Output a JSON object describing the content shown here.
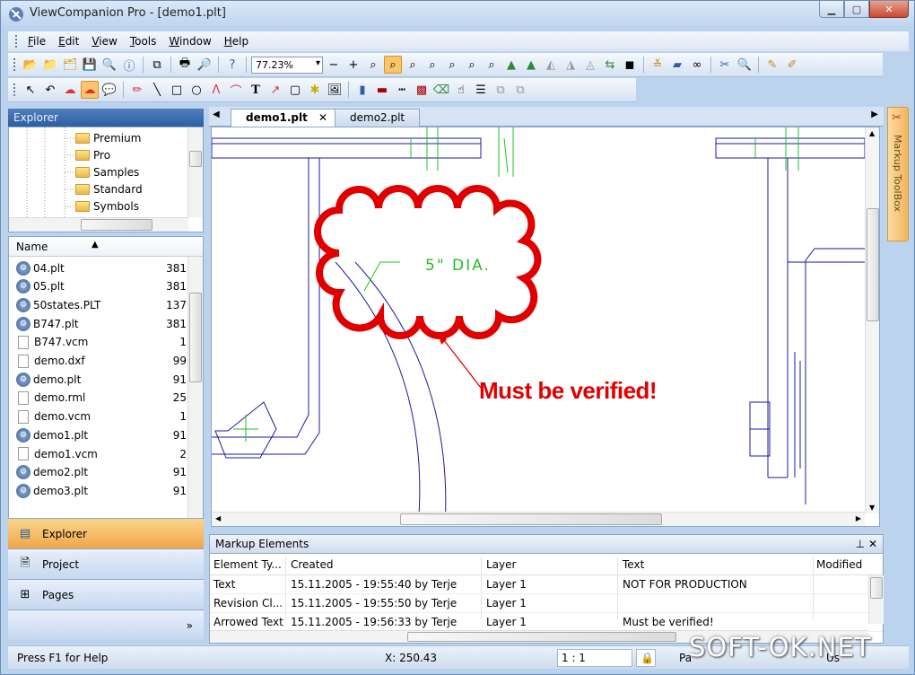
{
  "window": {
    "title": "ViewCompanion Pro - [demo1.plt]",
    "buttons": {
      "min": "▁",
      "max": "▢",
      "close": "✕"
    }
  },
  "menu": [
    "File",
    "Edit",
    "View",
    "Tools",
    "Window",
    "Help"
  ],
  "toolbar": {
    "zoom_value": "77.23%"
  },
  "explorer": {
    "title": "Explorer",
    "tree": [
      "Premium",
      "Pro",
      "Samples",
      "Standard",
      "Symbols"
    ],
    "list_header": "Name",
    "files": [
      {
        "name": "04.plt",
        "size": "381",
        "type": "plt"
      },
      {
        "name": "05.plt",
        "size": "381",
        "type": "plt"
      },
      {
        "name": "50states.PLT",
        "size": "137",
        "type": "plt"
      },
      {
        "name": "B747.plt",
        "size": "381",
        "type": "plt"
      },
      {
        "name": "B747.vcm",
        "size": "1",
        "type": "doc"
      },
      {
        "name": "demo.dxf",
        "size": "99",
        "type": "doc"
      },
      {
        "name": "demo.plt",
        "size": "91",
        "type": "plt"
      },
      {
        "name": "demo.rml",
        "size": "25",
        "type": "doc"
      },
      {
        "name": "demo.vcm",
        "size": "1",
        "type": "doc"
      },
      {
        "name": "demo1.plt",
        "size": "91",
        "type": "plt"
      },
      {
        "name": "demo1.vcm",
        "size": "2",
        "type": "doc"
      },
      {
        "name": "demo2.plt",
        "size": "91",
        "type": "plt"
      },
      {
        "name": "demo3.plt",
        "size": "91",
        "type": "plt"
      }
    ]
  },
  "nav": {
    "explorer": "Explorer",
    "project": "Project",
    "pages": "Pages",
    "more": "»"
  },
  "tabs": [
    {
      "label": "demo1.plt",
      "close": "✕"
    },
    {
      "label": "demo2.plt"
    }
  ],
  "side_panel": {
    "label": "Markup ToolBox"
  },
  "drawing": {
    "dim_text": "5\" DIA.",
    "callout": "Must be verified!"
  },
  "markup": {
    "title": "Markup Elements",
    "ctrls": "⊥ ✕",
    "columns": [
      "Element Ty...",
      "Created",
      "Layer",
      "Text",
      "Modified"
    ],
    "rows": [
      {
        "type": "Text",
        "created": "15.11.2005 - 19:55:40 by Terje",
        "layer": "Layer 1",
        "text": "NOT FOR PRODUCTION"
      },
      {
        "type": "Revision Cl...",
        "created": "15.11.2005 - 19:55:50 by Terje",
        "layer": "Layer 1",
        "text": ""
      },
      {
        "type": "Arrowed Text",
        "created": "15.11.2005 - 19:56:33 by Terje",
        "layer": "Layer 1",
        "text": "Must be verified!"
      }
    ]
  },
  "status": {
    "help": "Press F1 for Help",
    "coord": "X: 250.43",
    "scale": "1 : 1",
    "p1": "Pa",
    "p2": "Us"
  },
  "watermark": "SOFT-OK.NET",
  "colors": {
    "accent": "#f0a64a",
    "markup_red": "#e00000",
    "drawing_blue": "#1a1aa0",
    "dim_green": "#22c022"
  }
}
